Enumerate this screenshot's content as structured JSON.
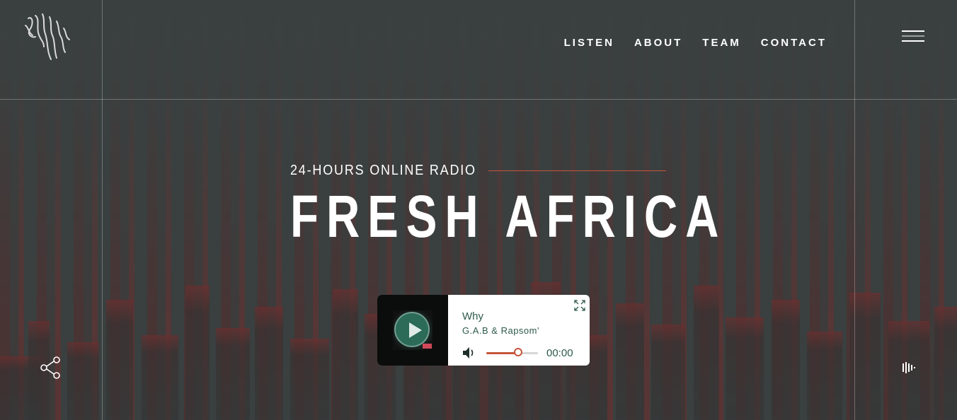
{
  "nav": {
    "items": [
      {
        "label": "LISTEN"
      },
      {
        "label": "ABOUT"
      },
      {
        "label": "TEAM"
      },
      {
        "label": "CONTACT"
      }
    ]
  },
  "hero": {
    "subtitle": "24-HOURS ONLINE RADIO",
    "title": "FRESH AFRICA"
  },
  "player": {
    "track_title": "Why",
    "artist": "G.A.B & Rapsom'",
    "time": "00:00",
    "volume": 0.62
  },
  "colors": {
    "accent": "#c6553a",
    "player_text": "#2e5a4c",
    "background": "#3a3f3f"
  },
  "icons": [
    "logo-icon",
    "menu-icon",
    "play-icon",
    "expand-icon",
    "volume-icon",
    "share-icon",
    "equalizer-icon"
  ]
}
